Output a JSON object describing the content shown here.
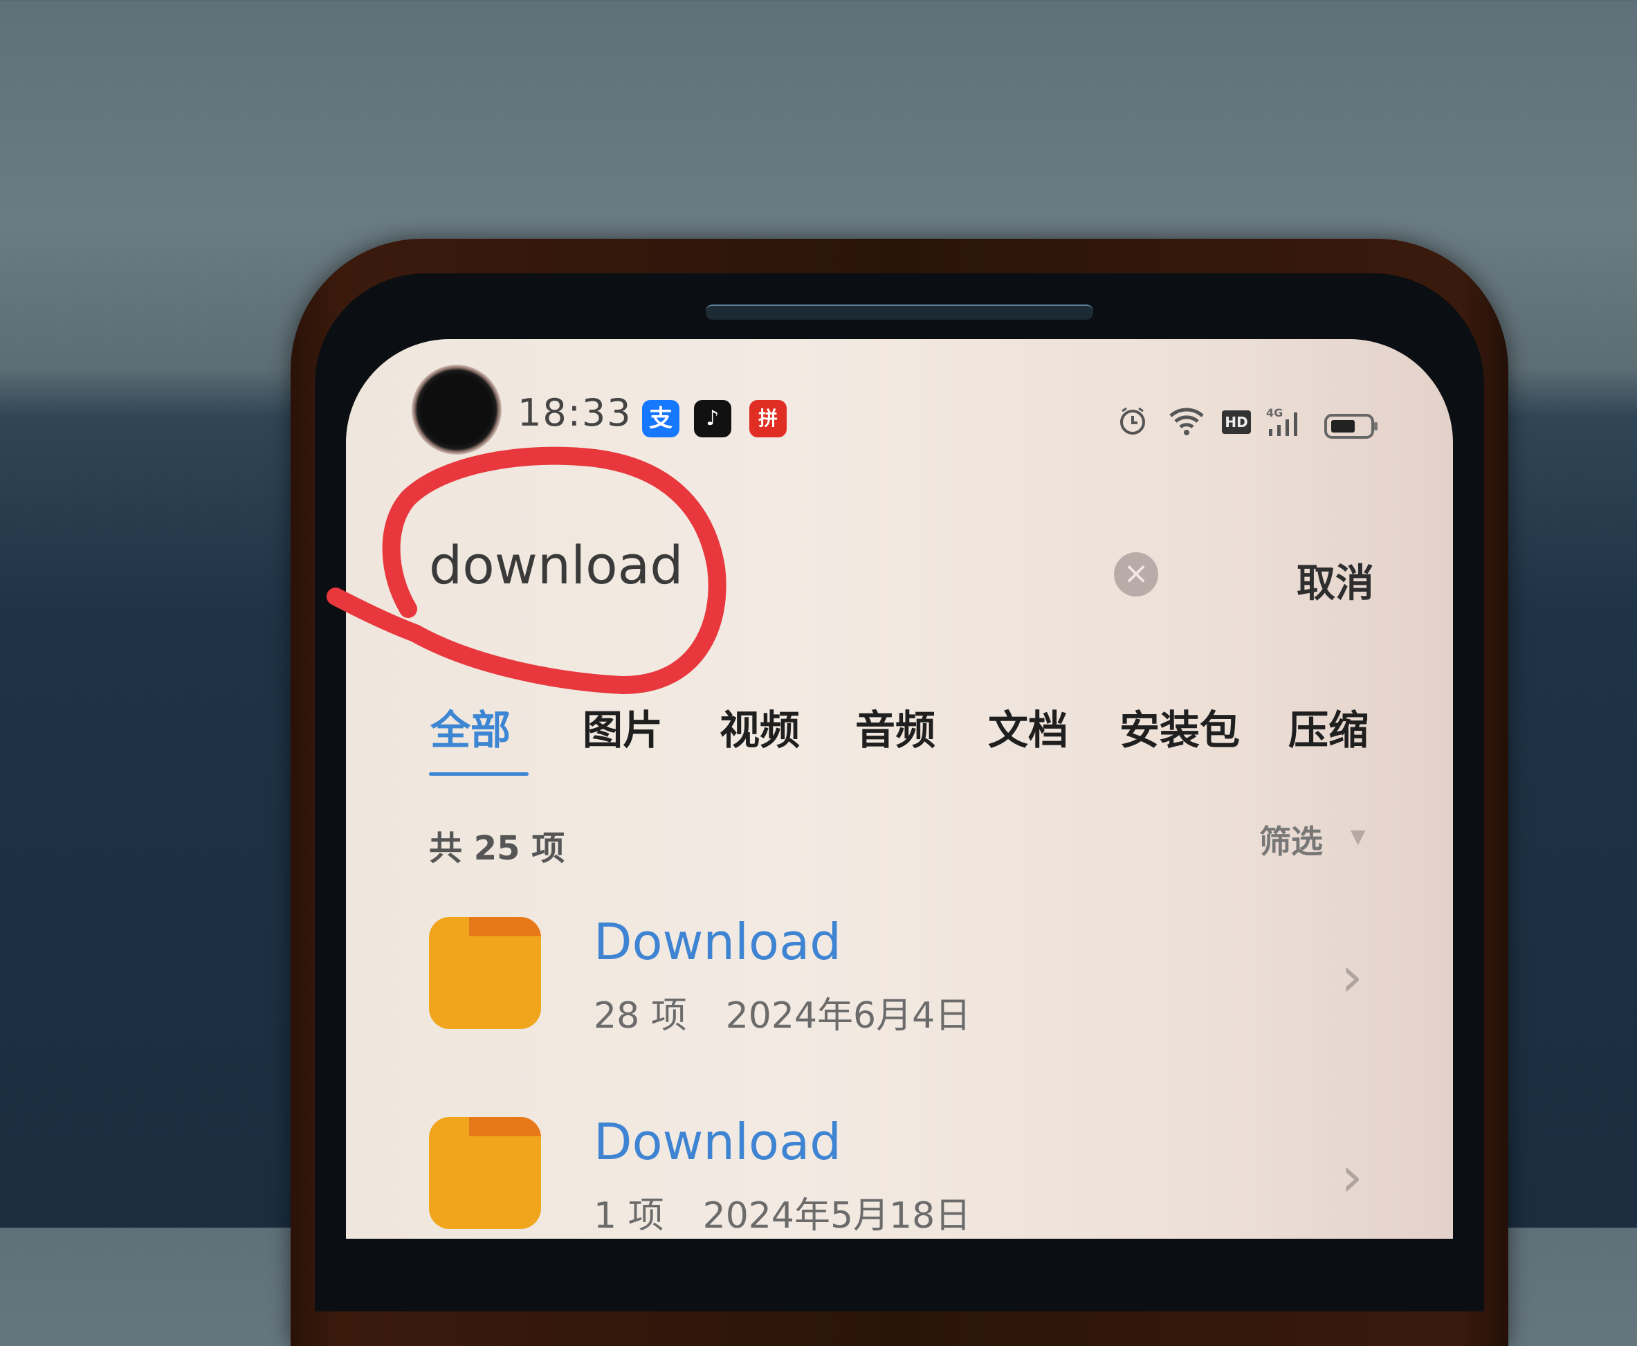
{
  "status_bar": {
    "time": "18:33",
    "notification_apps": [
      {
        "name": "alipay-icon",
        "glyph": "支",
        "color": "#1677ff"
      },
      {
        "name": "tiktok-icon",
        "glyph": "♪",
        "color": "#111111"
      },
      {
        "name": "pinduoduo-icon",
        "glyph": "拼",
        "color": "#e02e24"
      }
    ],
    "indicators": {
      "alarm": "⏰",
      "wifi": "WiFi",
      "hd": "HD",
      "network": "4G",
      "battery_percent": 60
    }
  },
  "search": {
    "query": "download",
    "clear_icon": "×",
    "cancel_label": "取消"
  },
  "tabs": [
    {
      "label": "全部",
      "active": true
    },
    {
      "label": "图片",
      "active": false
    },
    {
      "label": "视频",
      "active": false
    },
    {
      "label": "音频",
      "active": false
    },
    {
      "label": "文档",
      "active": false
    },
    {
      "label": "安装包",
      "active": false
    },
    {
      "label": "压缩",
      "active": false
    }
  ],
  "results": {
    "count_label": "共 25 项",
    "filter_label": "筛选",
    "filter_caret": "▼",
    "items": [
      {
        "name": "Download",
        "item_count": "28 项",
        "date": "2024年6月4日"
      },
      {
        "name": "Download",
        "item_count": "1 项",
        "date": "2024年5月18日"
      }
    ]
  },
  "colors": {
    "accent": "#3d86d4",
    "folder": "#f1a51c",
    "annotation": "#e8383d"
  },
  "annotation": {
    "type": "hand-drawn circle",
    "target": "search query"
  }
}
